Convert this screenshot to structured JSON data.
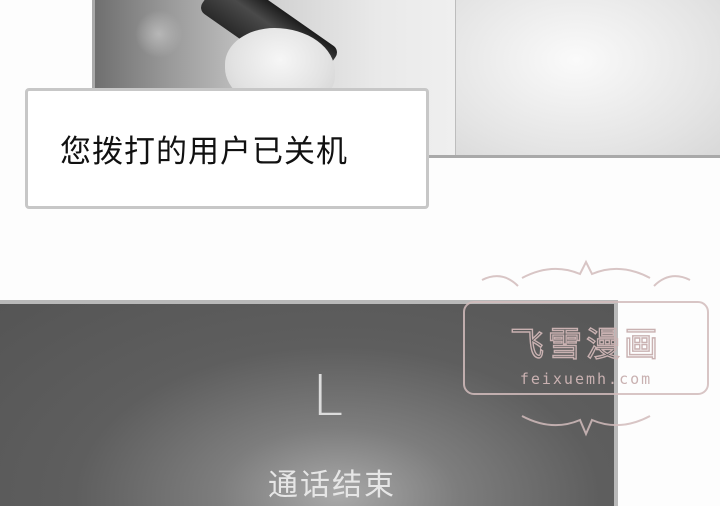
{
  "caption": {
    "text": "您拨打的用户已关机"
  },
  "call_screen": {
    "contact_initial": "L",
    "status": "通话结束"
  },
  "watermark": {
    "title": "飞雪漫画",
    "site": "feixuemh.com"
  },
  "colors": {
    "panel_dark": "#5e5e5e",
    "border_gray": "#b9b9b9",
    "caption_border": "#c7c7c7"
  },
  "icons": [
    "watermark-logo"
  ]
}
